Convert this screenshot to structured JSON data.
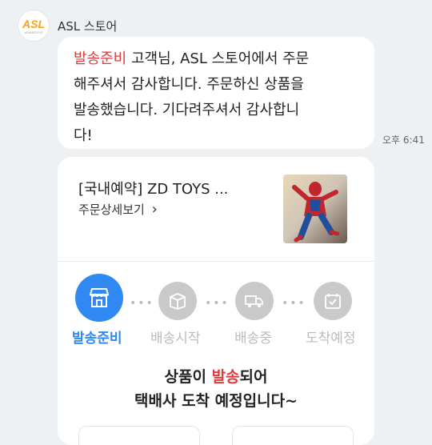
{
  "sender": {
    "name": "ASL 스토어",
    "logo_text": "ASL",
    "logo_subtext": "ASIANTOYS"
  },
  "message": {
    "highlight": "발송준비",
    "line1_rest": " 고객님, ASL 스토어에서 주문",
    "line2": "해주셔서 감사합니다. 주문하신 상품을",
    "line3": "발송했습니다. 기다려주셔서 감사합니",
    "line4": "다!"
  },
  "timestamp": "오후 6:41",
  "order_card": {
    "product_title": "[국내예약] ZD TOYS ...",
    "detail_link": "주문상세보기",
    "detail_chevron": "›",
    "steps": [
      {
        "label": "발송준비",
        "icon": "store-icon",
        "active": true
      },
      {
        "label": "배송시작",
        "icon": "box-icon",
        "active": false
      },
      {
        "label": "배송중",
        "icon": "truck-icon",
        "active": false
      },
      {
        "label": "도착예정",
        "icon": "calendar-check-icon",
        "active": false
      }
    ],
    "status_message": {
      "part1": "상품이 ",
      "highlight": "발송",
      "part2": "되어",
      "line2": "택배사 도착 예정입니다~"
    }
  },
  "colors": {
    "accent_blue": "#2f89f0",
    "highlight_red": "#e03a3a",
    "logo_orange": "#f5a21b",
    "background": "#eef1f4"
  }
}
